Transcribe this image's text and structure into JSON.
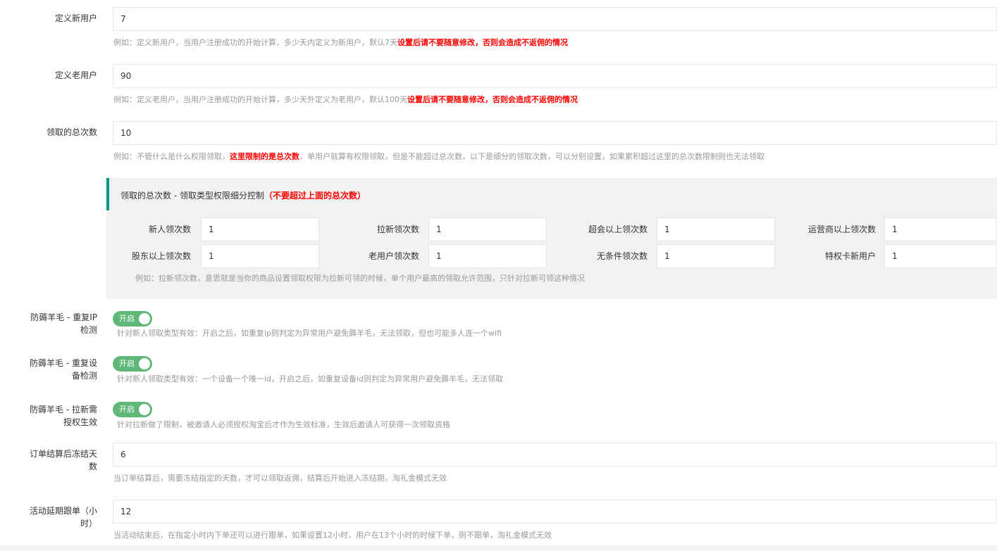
{
  "fields": {
    "new_user": {
      "label": "定义新用户",
      "value": "7",
      "help_pre": "例如：定义新用户，当用户注册成功的开始计算，多少天内定义为新用户，默认7天",
      "help_warn": "设置后请不要随意修改，否则会造成不返佣的情况"
    },
    "old_user": {
      "label": "定义老用户",
      "value": "90",
      "help_pre": "例如：定义老用户，当用户注册成功的开始计算，多少天外定义为老用户，默认100天",
      "help_warn": "设置后请不要随意修改，否则会造成不返佣的情况"
    },
    "total_claims": {
      "label": "领取的总次数",
      "value": "10",
      "help_pre": "例如：不管什么是什么权限领取，",
      "help_warn": "这里限制的是总次数",
      "help_post": "，单用户就算有权限领取，但是不能超过总次数，以下是细分的领取次数，可以分别设置，如果累积超过这里的总次数限制则也无法领取"
    }
  },
  "subsection": {
    "title": "领取的总次数 - 领取类型权限细分控制",
    "title_warn": "（不要超过上面的总次数）",
    "items": [
      {
        "label": "新人领次数",
        "value": "1"
      },
      {
        "label": "拉新领次数",
        "value": "1"
      },
      {
        "label": "超会以上领次数",
        "value": "1"
      },
      {
        "label": "运营商以上领次数",
        "value": "1"
      },
      {
        "label": "股东以上领次数",
        "value": "1"
      },
      {
        "label": "老用户领次数",
        "value": "1"
      },
      {
        "label": "无条件领次数",
        "value": "1"
      },
      {
        "label": "特权卡新用户",
        "value": "1"
      }
    ],
    "help": "例如：拉新领次数，意思就是当你的商品设置领取权限为拉新可领的时候，单个用户最高的领取允许范围，只针对拉新可领这种情况"
  },
  "toggles": {
    "repeat_ip": {
      "label_line1": "防薅羊毛 - 重复IP",
      "label_line2": "检测",
      "state": "开启",
      "help": "针对新人领取类型有效：开启之后，如重复ip则判定为异常用户避免薅羊毛，无法领取，但也可能多人连一个wifi"
    },
    "repeat_device": {
      "label_line1": "防薅羊毛 - 重复设",
      "label_line2": "备检测",
      "state": "开启",
      "help": "针对新人领取类型有效：一个设备一个唯一id，开启之后，如重复设备id则判定为异常用户避免薅羊毛，无法领取"
    },
    "referral_auth": {
      "label_line1": "防薅羊毛 - 拉新需",
      "label_line2": "授权生效",
      "state": "开启",
      "help": "针对拉新做了限制，被邀请人必须授权淘宝后才作为生效标准，生效后邀请人可获得一次领取资格"
    }
  },
  "freeze_days": {
    "label_line1": "订单结算后冻结天",
    "label_line2": "数",
    "value": "6",
    "help": "当订单结算后，需要冻结指定的天数，才可以领取返佣，结算后开始进入冻结期，淘礼金模式无效"
  },
  "delay_hours": {
    "label_line1": "活动延期跟单（小",
    "label_line2": "时）",
    "value": "12",
    "help": "当活动结束后，在指定小时内下单还可以进行跟单，如果设置12小时，用户在13个小时的时候下单，则不跟单，淘礼金模式无效"
  },
  "colors": {
    "accent": "#009688",
    "switch_on": "#5fb878",
    "warning": "#ff0000"
  }
}
